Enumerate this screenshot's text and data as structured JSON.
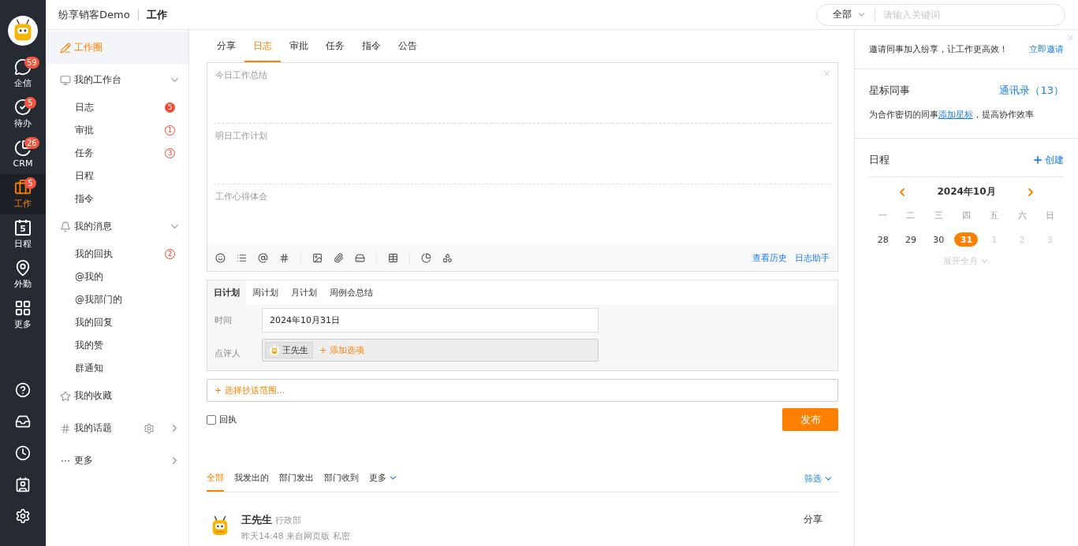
{
  "header": {
    "company": "纷享销客Demo",
    "module": "工作",
    "search": {
      "scope": "全部",
      "placeholder": "请输入关键词"
    }
  },
  "rail": {
    "items": [
      {
        "label": "企信",
        "badge": "59",
        "selected": false
      },
      {
        "label": "待办",
        "badge": "5",
        "selected": false
      },
      {
        "label": "CRM",
        "badge": "26",
        "selected": false
      },
      {
        "label": "工作",
        "badge": "5",
        "selected": true
      },
      {
        "label": "日程",
        "icon_text": "5",
        "selected": false
      },
      {
        "label": "外勤",
        "selected": false
      },
      {
        "label": "更多",
        "selected": false
      }
    ]
  },
  "sidebar": {
    "items": [
      {
        "label": "工作圈",
        "selected": true
      },
      {
        "label": "我的工作台",
        "selected": false,
        "expanded": true,
        "children": [
          {
            "label": "日志",
            "badge": "5",
            "badge_filled": true
          },
          {
            "label": "审批",
            "badge": "1",
            "badge_filled": false
          },
          {
            "label": "任务",
            "badge": "3",
            "badge_filled": false
          },
          {
            "label": "日程"
          },
          {
            "label": "指令"
          }
        ]
      },
      {
        "label": "我的消息",
        "selected": false,
        "expanded": true,
        "children": [
          {
            "label": "我的回执",
            "badge": "2",
            "badge_filled": false
          },
          {
            "label": "@我的"
          },
          {
            "label": "@我部门的"
          },
          {
            "label": "我的回复"
          },
          {
            "label": "我的赞"
          },
          {
            "label": "群通知"
          }
        ]
      },
      {
        "label": "我的收藏",
        "selected": false
      },
      {
        "label": "我的话题",
        "selected": false,
        "expanded": false,
        "settings": true
      },
      {
        "label": "更多",
        "selected": false,
        "expanded": false
      }
    ]
  },
  "main": {
    "tabs": [
      {
        "label": "分享",
        "selected": false
      },
      {
        "label": "日志",
        "selected": true
      },
      {
        "label": "审批",
        "selected": false
      },
      {
        "label": "任务",
        "selected": false
      },
      {
        "label": "指令",
        "selected": false
      },
      {
        "label": "公告",
        "selected": false
      }
    ],
    "editor": {
      "sections": [
        {
          "placeholder": "今日工作总结"
        },
        {
          "placeholder": "明日工作计划"
        },
        {
          "placeholder": "工作心得体会"
        }
      ],
      "links": [
        "查看历史",
        "日志助手"
      ]
    },
    "plan": {
      "tabs": [
        {
          "label": "日计划",
          "selected": true
        },
        {
          "label": "周计划",
          "selected": false
        },
        {
          "label": "月计划",
          "selected": false
        },
        {
          "label": "周例会总结",
          "selected": false
        }
      ],
      "time_label": "时间",
      "time_value": "2024年10月31日",
      "reviewer_label": "点评人",
      "reviewer": "王先生",
      "add_option": "+ 添加选项"
    },
    "cc": "+ 选择抄送范围...",
    "receipt": {
      "label": "回执",
      "checked": false
    },
    "publish": "发布",
    "feed": {
      "tabs": [
        {
          "label": "全部",
          "selected": true
        },
        {
          "label": "我发出的",
          "selected": false
        },
        {
          "label": "部门发出",
          "selected": false
        },
        {
          "label": "部门收到",
          "selected": false
        },
        {
          "label": "更多",
          "selected": false
        }
      ],
      "filter": "筛选",
      "post": {
        "author": "王先生",
        "department": "行政部",
        "meta": "昨天14:48  来自网页版  私密",
        "type": "分享"
      }
    }
  },
  "right": {
    "invite": {
      "text": "邀请同事加入纷享，让工作更高效！",
      "link": "立即邀请"
    },
    "starred": {
      "title": "星标同事",
      "contacts": "通讯录",
      "count": "（13）",
      "hint_before": "为合作密切的同事",
      "hint_link": "添加星标",
      "hint_after": "，提高协作效率"
    },
    "schedule": {
      "title": "日程",
      "create": "创建",
      "month": "2024年10月",
      "weekdays": [
        "一",
        "二",
        "三",
        "四",
        "五",
        "六",
        "日"
      ],
      "days": [
        {
          "label": "28",
          "selected": false,
          "other_month": false
        },
        {
          "label": "29",
          "selected": false,
          "other_month": false
        },
        {
          "label": "30",
          "selected": false,
          "other_month": false
        },
        {
          "label": "31",
          "selected": true,
          "other_month": false
        },
        {
          "label": "1",
          "selected": false,
          "other_month": true
        },
        {
          "label": "2",
          "selected": false,
          "other_month": true
        },
        {
          "label": "3",
          "selected": false,
          "other_month": true
        }
      ],
      "expand": "展开全月"
    }
  }
}
